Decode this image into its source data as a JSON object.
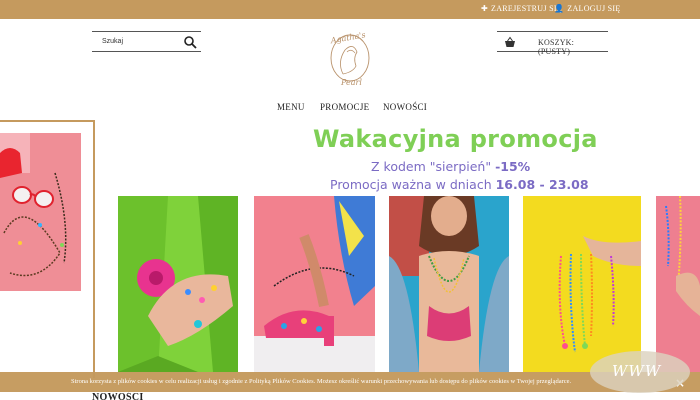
{
  "topbar": {
    "register_label": "ZAREJESTRUJ SIĘ",
    "login_label": "ZALOGUJ SIĘ",
    "register_icon": "plus-icon",
    "login_icon": "user-icon",
    "background": "#c59a5e"
  },
  "search": {
    "placeholder": "Szukaj",
    "icon": "search-icon"
  },
  "logo": {
    "text_top": "Agatha's",
    "text_bottom": "Pearl"
  },
  "cart": {
    "label": "KOSZYK: (PUSTY)",
    "icon": "basket-icon"
  },
  "nav": {
    "items": [
      "MENU",
      "PROMOCJE",
      "NOWOŚCI"
    ]
  },
  "promo": {
    "title": "Wakacyjna promocja",
    "code_prefix": "Z kodem \"sierpień\"",
    "code_discount": "-15%",
    "dates_prefix": "Promocja ważna w dniach",
    "dates_range": "16.08 - 23.08",
    "title_color": "#7fcf56",
    "text_color": "#7b6bc4"
  },
  "sections": {
    "new_heading": "NOWOŚCI"
  },
  "cookie_bar": {
    "text": "Strona korzysta z plików cookies w celu realizacji usług i zgodnie z Polityką Plików Cookies. Możesz określić warunki przechowywania lub dostępu do plików cookies w Twojej przeglądarce.",
    "close_label": "×"
  },
  "badge": {
    "label": "WWW"
  }
}
